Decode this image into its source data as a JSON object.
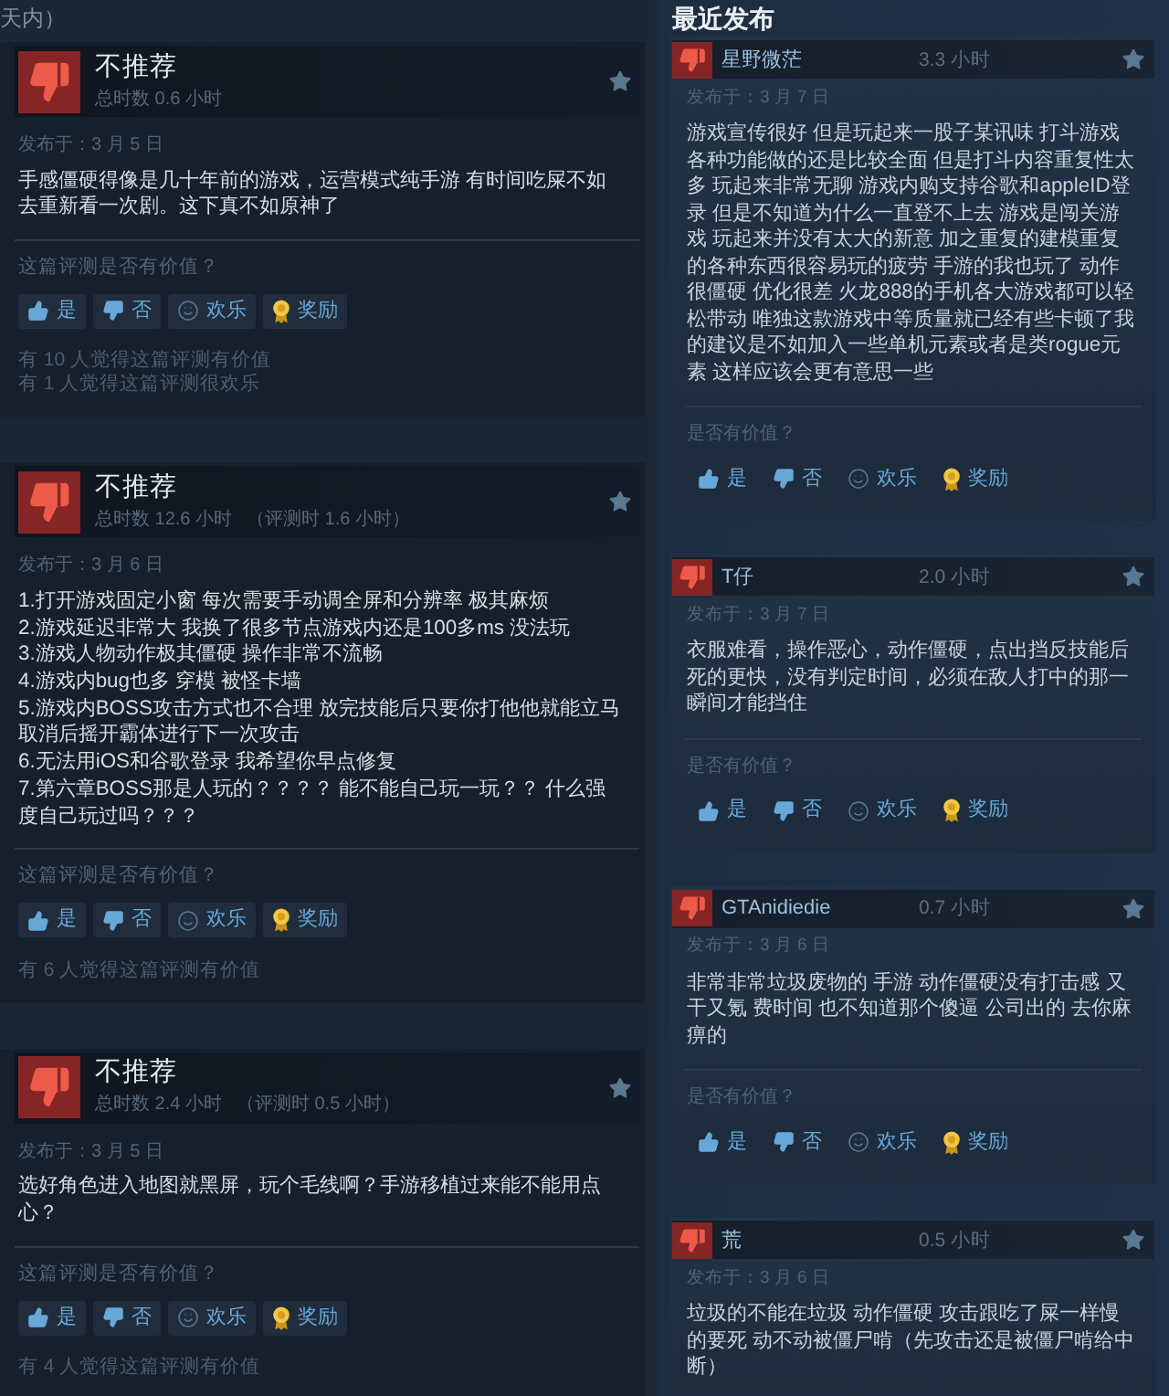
{
  "header_fragment": "天内）",
  "reviews": [
    {
      "recommended": false,
      "verdict": "不推荐",
      "playtime": "总时数 0.6 小时",
      "posted": "发布于：3 月 5 日",
      "paragraphs": [
        "手感僵硬得像是几十年前的游戏，运营模式纯手游 有时间吃屎不如去重新看一次剧。这下真不如原神了"
      ],
      "prompt": "这篇评测是否有价值？",
      "actions": [
        {
          "kind": "yes",
          "label": "是"
        },
        {
          "kind": "no",
          "label": "否"
        },
        {
          "kind": "funny",
          "label": "欢乐"
        },
        {
          "kind": "award",
          "label": "奖励"
        }
      ],
      "stats": [
        "有 10 人觉得这篇评测有价值",
        "有 1 人觉得这篇评测很欢乐"
      ]
    },
    {
      "recommended": false,
      "verdict": "不推荐",
      "playtime": "总时数 12.6 小时",
      "playtime_at_review": "（评测时 1.6 小时）",
      "posted": "发布于：3 月 6 日",
      "paragraphs": [
        "1.打开游戏固定小窗 每次需要手动调全屏和分辨率 极其麻烦",
        "2.游戏延迟非常大 我换了很多节点游戏内还是100多ms 没法玩",
        "3.游戏人物动作极其僵硬 操作非常不流畅",
        "4.游戏内bug也多 穿模 被怪卡墙",
        "5.游戏内BOSS攻击方式也不合理 放完技能后只要你打他他就能立马取消后摇开霸体进行下一次攻击",
        "6.无法用iOS和谷歌登录 我希望你早点修复",
        "7.第六章BOSS那是人玩的？？？？ 能不能自己玩一玩？？ 什么强度自己玩过吗？？？"
      ],
      "prompt": "这篇评测是否有价值？",
      "actions": [
        {
          "kind": "yes",
          "label": "是"
        },
        {
          "kind": "no",
          "label": "否"
        },
        {
          "kind": "funny",
          "label": "欢乐"
        },
        {
          "kind": "award",
          "label": "奖励"
        }
      ],
      "stats": [
        "有 6 人觉得这篇评测有价值"
      ]
    },
    {
      "recommended": false,
      "verdict": "不推荐",
      "playtime": "总时数 2.4 小时",
      "playtime_at_review": "（评测时 0.5 小时）",
      "posted": "发布于：3 月 5 日",
      "paragraphs": [
        "选好角色进入地图就黑屏，玩个毛线啊？手游移植过来能不能用点心？"
      ],
      "prompt": "这篇评测是否有价值？",
      "actions": [
        {
          "kind": "yes",
          "label": "是"
        },
        {
          "kind": "no",
          "label": "否"
        },
        {
          "kind": "funny",
          "label": "欢乐"
        },
        {
          "kind": "award",
          "label": "奖励"
        }
      ],
      "stats": [
        "有 4 人觉得这篇评测有价值"
      ]
    }
  ],
  "recent": {
    "title": "最近发布",
    "reviews": [
      {
        "recommended": false,
        "author": "星野微茫",
        "hours": "3.3 小时",
        "posted": "发布于：3 月 7 日",
        "text": "游戏宣传很好 但是玩起来一股子某讯味 打斗游戏各种功能做的还是比较全面 但是打斗内容重复性太多 玩起来非常无聊 游戏内购支持谷歌和appleID登录 但是不知道为什么一直登不上去 游戏是闯关游戏 玩起来并没有太大的新意 加之重复的建模重复的各种东西很容易玩的疲劳 手游的我也玩了 动作很僵硬 优化很差 火龙888的手机各大游戏都可以轻松带动 唯独这款游戏中等质量就已经有些卡顿了我的建议是不如加入一些单机元素或者是类rogue元素 这样应该会更有意思一些",
        "prompt": "是否有价值？",
        "actions": [
          {
            "kind": "yes",
            "label": "是"
          },
          {
            "kind": "no",
            "label": "否"
          },
          {
            "kind": "funny",
            "label": "欢乐"
          },
          {
            "kind": "award",
            "label": "奖励"
          }
        ]
      },
      {
        "recommended": false,
        "author": "T仔",
        "hours": "2.0 小时",
        "posted": "发布于：3 月 7 日",
        "text": "衣服难看，操作恶心，动作僵硬，点出挡反技能后死的更快，没有判定时间，必须在敌人打中的那一瞬间才能挡住",
        "prompt": "是否有价值？",
        "actions": [
          {
            "kind": "yes",
            "label": "是"
          },
          {
            "kind": "no",
            "label": "否"
          },
          {
            "kind": "funny",
            "label": "欢乐"
          },
          {
            "kind": "award",
            "label": "奖励"
          }
        ]
      },
      {
        "recommended": false,
        "author": "GTAnidiedie",
        "hours": "0.7 小时",
        "posted": "发布于：3 月 6 日",
        "text": "非常非常垃圾废物的 手游 动作僵硬没有打击感 又干又氪 费时间 也不知道那个傻逼 公司出的 去你麻痹的",
        "prompt": "是否有价值？",
        "actions": [
          {
            "kind": "yes",
            "label": "是"
          },
          {
            "kind": "no",
            "label": "否"
          },
          {
            "kind": "funny",
            "label": "欢乐"
          },
          {
            "kind": "award",
            "label": "奖励"
          }
        ]
      },
      {
        "recommended": false,
        "author": "荒",
        "hours": "0.5 小时",
        "posted": "发布于：3 月 6 日",
        "text": "垃圾的不能在垃圾 动作僵硬 攻击跟吃了屎一样慢的要死 动不动被僵尸啃（先攻击还是被僵尸啃给中断）"
      }
    ]
  }
}
